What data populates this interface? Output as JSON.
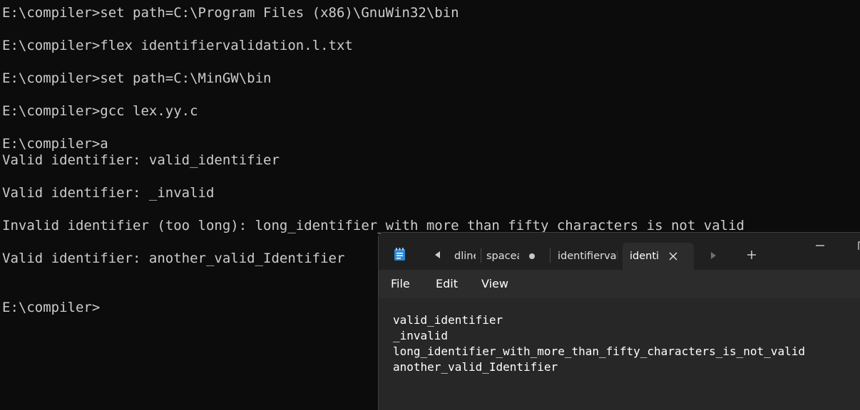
{
  "console": {
    "lines": [
      "E:\\compiler>set path=C:\\Program Files (x86)\\GnuWin32\\bin",
      "E:\\compiler>flex identifiervalidation.l.txt",
      "E:\\compiler>set path=C:\\MinGW\\bin",
      "E:\\compiler>gcc lex.yy.c",
      "E:\\compiler>a",
      "Valid identifier: valid_identifier",
      "Valid identifier: _invalid",
      "Invalid identifier (too long): long_identifier_with_more_than_fifty_characters_is_not_valid",
      "Valid identifier: another_valid_Identifier",
      "E:\\compiler>"
    ]
  },
  "notepad": {
    "tabs": [
      {
        "label": "dline"
      },
      {
        "label": "spacea"
      },
      {
        "label": "identifiervali"
      },
      {
        "label": "identi"
      }
    ],
    "menu": {
      "file": "File",
      "edit": "Edit",
      "view": "View"
    },
    "content": [
      "valid_identifier",
      "_invalid",
      "long_identifier_with_more_than_fifty_characters_is_not_valid",
      "another_valid_Identifier"
    ],
    "icons": {
      "app": "notepad-icon",
      "prev": "tab-scroll-left-icon",
      "next": "tab-scroll-right-icon",
      "add": "plus-icon",
      "close": "close-icon",
      "minimize": "minimize-icon",
      "maximize": "maximize-icon",
      "unsaved": "unsaved-dot-icon"
    },
    "colors": {
      "console_bg": "#0c0c0c",
      "console_text": "#cccccc",
      "notepad_bg": "#272727",
      "titlebar_bg": "#202020",
      "accent": "#1f7ad4"
    }
  }
}
